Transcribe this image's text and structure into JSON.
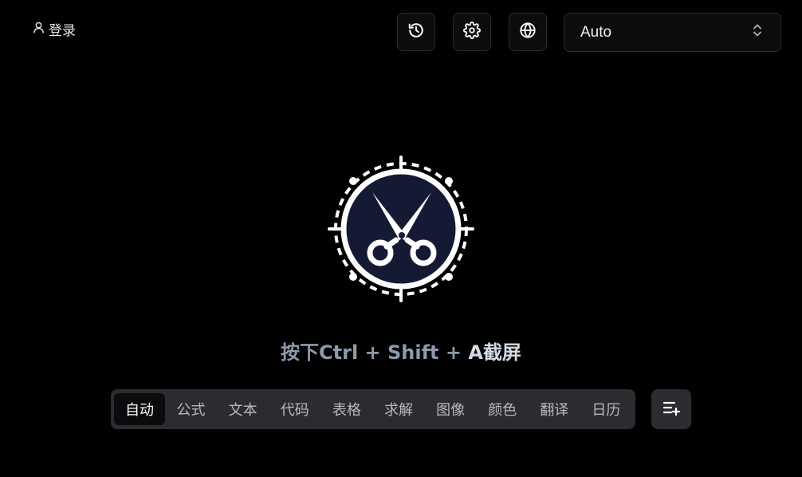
{
  "header": {
    "login_label": "登录",
    "icons": [
      "user-icon",
      "history-icon",
      "settings-icon",
      "globe-icon",
      "chevron-updown-icon"
    ]
  },
  "language_select": {
    "value": "Auto"
  },
  "hint": {
    "prefix": "按下Ctrl + Shift + ",
    "key": "A",
    "suffix": "截屏"
  },
  "tabs": [
    {
      "label": "自动",
      "active": true
    },
    {
      "label": "公式"
    },
    {
      "label": "文本"
    },
    {
      "label": "代码"
    },
    {
      "label": "表格"
    },
    {
      "label": "求解"
    },
    {
      "label": "图像"
    },
    {
      "label": "颜色"
    },
    {
      "label": "翻译"
    },
    {
      "label": "日历"
    }
  ],
  "colors": {
    "background": "#000000",
    "surface": "#2c2c30",
    "logo_fill": "#141a33",
    "hint_text": "#8e9aab"
  }
}
